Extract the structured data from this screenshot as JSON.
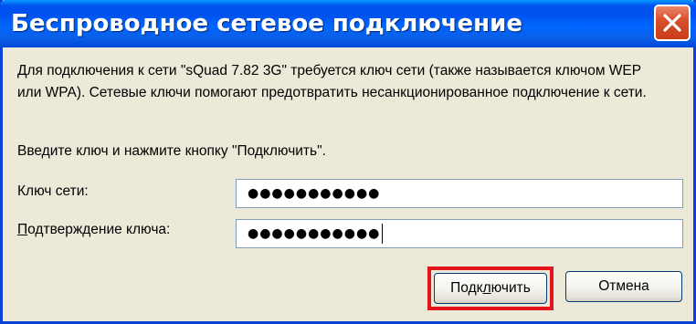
{
  "window": {
    "title": "Беспроводное сетевое подключение"
  },
  "dialog": {
    "message": "Для подключения к сети \"sQuad 7.82 3G\" требуется ключ сети (также называется ключом WEP или WPA). Сетевые ключи помогают предотвратить несанкционированное подключение к сети.",
    "prompt": "Введите ключ и нажмите кнопку \"Подключить\".",
    "key_label": "Ключ сети:",
    "key_value": "●●●●●●●●●●●",
    "confirm_label_first": "П",
    "confirm_label_rest": "одтверждение ключа:",
    "confirm_value": "●●●●●●●●●●●"
  },
  "buttons": {
    "connect_pre": "Подк",
    "connect_mnemonic": "л",
    "connect_post": "ючить",
    "cancel": "Отмена"
  },
  "colors": {
    "titlebar": "#0053ee",
    "close": "#d8502c",
    "highlight": "#e2141c"
  }
}
